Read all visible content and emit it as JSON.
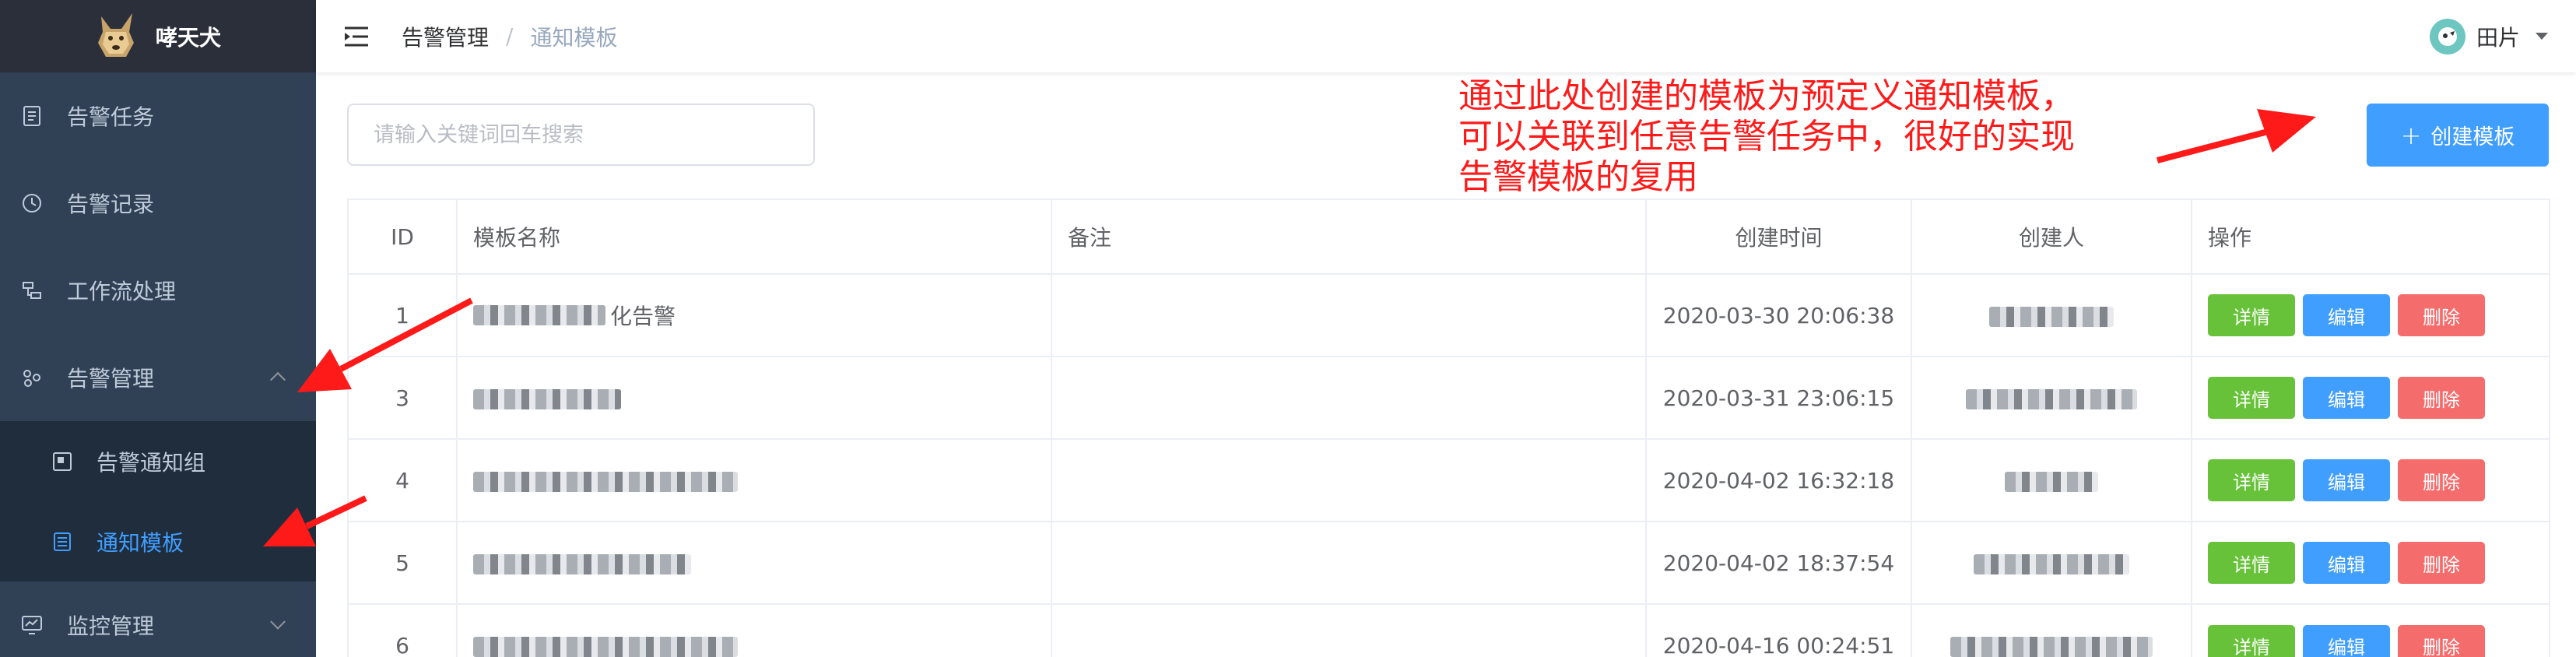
{
  "app": {
    "title": "哮天犬"
  },
  "sidebar": {
    "items": [
      {
        "label": "告警任务",
        "icon": "task-icon"
      },
      {
        "label": "告警记录",
        "icon": "clock-icon"
      },
      {
        "label": "工作流处理",
        "icon": "workflow-icon"
      },
      {
        "label": "告警管理",
        "icon": "alarm-manage-icon",
        "expanded": true,
        "children": [
          {
            "label": "告警通知组",
            "icon": "notify-group-icon"
          },
          {
            "label": "通知模板",
            "icon": "template-icon",
            "active": true
          }
        ]
      },
      {
        "label": "监控管理",
        "icon": "monitor-icon",
        "expanded": false
      }
    ]
  },
  "header": {
    "breadcrumb": [
      "告警管理",
      "通知模板"
    ],
    "breadcrumb_separator": "/",
    "user_name": "田片"
  },
  "toolbar": {
    "search_placeholder": "请输入关键词回车搜索",
    "create_label": "创建模板"
  },
  "annotation": {
    "text_lines": [
      "通过此处创建的模板为预定义通知模板，",
      "可以关联到任意告警任务中，很好的实现",
      "告警模板的复用"
    ],
    "color": "#ff1a1a"
  },
  "table": {
    "columns": [
      "ID",
      "模板名称",
      "备注",
      "创建时间",
      "创建人",
      "操作"
    ],
    "rows": [
      {
        "id": "1",
        "name_visible": "化告警",
        "remark": "",
        "created_at": "2020-03-30 20:06:38",
        "creator_visible": ""
      },
      {
        "id": "3",
        "name_visible": "",
        "remark": "",
        "created_at": "2020-03-31 23:06:15",
        "creator_visible": ""
      },
      {
        "id": "4",
        "name_visible": "",
        "remark": "",
        "created_at": "2020-04-02 16:32:18",
        "creator_visible": ""
      },
      {
        "id": "5",
        "name_visible": "",
        "remark": "",
        "created_at": "2020-04-02 18:37:54",
        "creator_visible": ""
      },
      {
        "id": "6",
        "name_visible": "",
        "remark": "",
        "created_at": "2020-04-16 00:24:51",
        "creator_visible": ""
      }
    ],
    "actions": {
      "detail": "详情",
      "edit": "编辑",
      "delete": "删除"
    }
  },
  "colors": {
    "sidebar_bg": "#304156",
    "logo_bg": "#2b2f3a",
    "submenu_bg": "#1f2d3d",
    "primary": "#409eff",
    "success": "#67c23a",
    "danger": "#f56c6c"
  }
}
